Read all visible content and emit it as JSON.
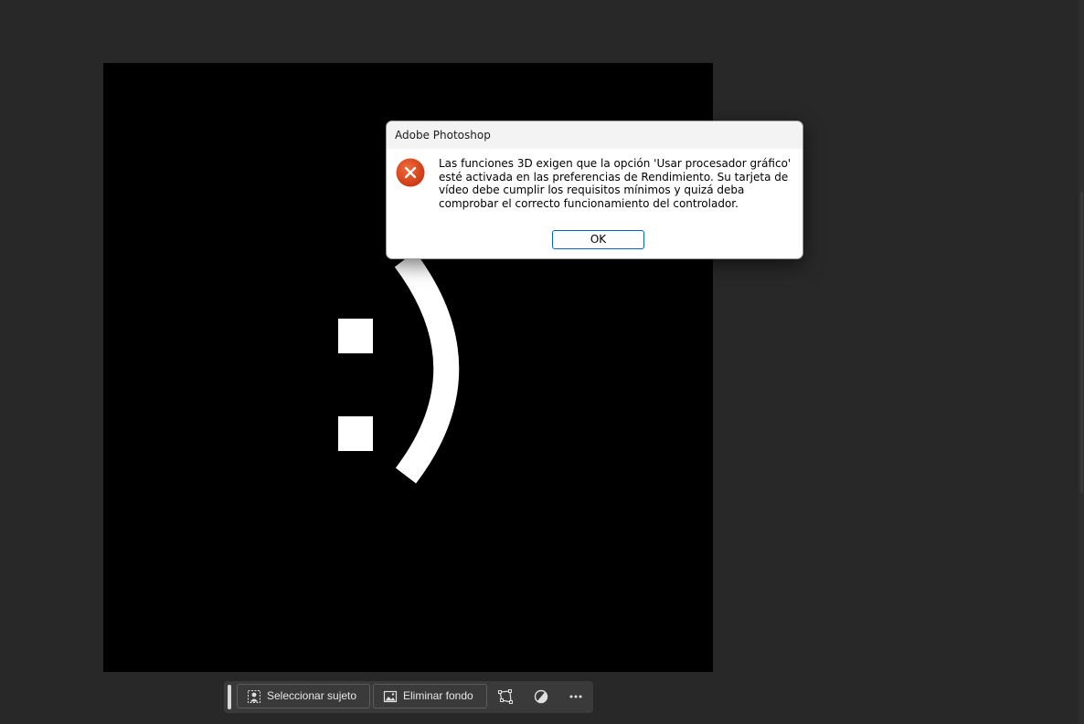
{
  "dialog": {
    "title": "Adobe Photoshop",
    "message": "Las funciones 3D exigen que la opción 'Usar procesador gráfico' esté activada en las preferencias de Rendimiento. Su tarjeta de vídeo debe cumplir los requisitos mínimos y quizá deba comprobar el correcto funcionamiento del controlador.",
    "ok_label": "OK",
    "icon": "error-x-icon",
    "icon_color": "#d9401b"
  },
  "canvas": {
    "content": "smiley-face-drawing",
    "background": "#000000",
    "foreground": "#ffffff"
  },
  "taskbar": {
    "select_subject_label": "Seleccionar sujeto",
    "select_subject_icon": "person-select-icon",
    "remove_background_label": "Eliminar fondo",
    "remove_background_icon": "image-icon",
    "transform_icon": "transform-icon",
    "adjustment_icon": "adjustment-circle-icon",
    "more_icon": "more-dots-icon"
  }
}
